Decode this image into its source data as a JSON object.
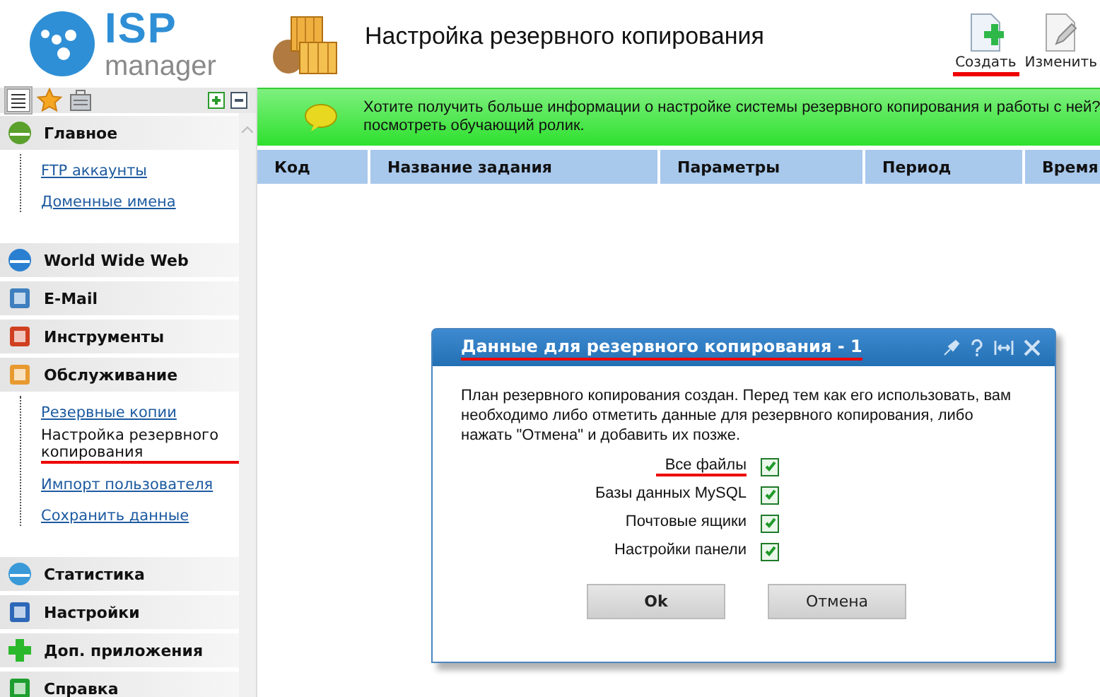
{
  "header": {
    "logo": {
      "brand": "ISP",
      "product": "manager"
    },
    "title": "Настройка резервного копирования",
    "toolbar": [
      {
        "label": "Создать",
        "kind": "create",
        "marked": true
      },
      {
        "label": "Изменить",
        "kind": "edit",
        "marked": false
      }
    ]
  },
  "sidebar": {
    "sections": [
      {
        "title": "Главное",
        "kind": "home",
        "items": [
          {
            "label": "FTP аккаунты",
            "selected": false,
            "marked": false
          },
          {
            "label": "Доменные имена",
            "selected": false,
            "marked": false
          }
        ]
      },
      {
        "title": "World Wide Web",
        "kind": "web"
      },
      {
        "title": "E-Mail",
        "kind": "mail"
      },
      {
        "title": "Инструменты",
        "kind": "tools"
      },
      {
        "title": "Обслуживание",
        "kind": "service",
        "items": [
          {
            "label": "Резервные копии",
            "selected": false,
            "marked": false
          },
          {
            "label": "Настройка резервного копирования",
            "selected": true,
            "marked": true
          },
          {
            "label": "Импорт пользователя",
            "selected": false,
            "marked": false
          },
          {
            "label": "Сохранить данные",
            "selected": false,
            "marked": false
          }
        ]
      },
      {
        "title": "Статистика",
        "kind": "stats"
      },
      {
        "title": "Настройки",
        "kind": "settings"
      },
      {
        "title": "Доп. приложения",
        "kind": "addons"
      },
      {
        "title": "Справка",
        "kind": "help"
      }
    ]
  },
  "banner": {
    "lines": [
      "Хотите получить больше информации о настройке системы резервного копирования и работы с ней?",
      "посмотреть обучающий ролик."
    ]
  },
  "table": {
    "columns": [
      "Код",
      "Название задания",
      "Параметры",
      "Период",
      "Время"
    ]
  },
  "dialog": {
    "title": "Данные для резервного копирования - 1",
    "title_marked": true,
    "message": "План резервного копирования создан. Перед тем как его использовать, вам необходимо либо отметить данные для резервного копирования, либо нажать \"Отмена\" и добавить их позже.",
    "options": [
      {
        "label": "Все файлы",
        "checked": true,
        "marked": true
      },
      {
        "label": "Базы данных MySQL",
        "checked": true,
        "marked": false
      },
      {
        "label": "Почтовые ящики",
        "checked": true,
        "marked": false
      },
      {
        "label": "Настройки панели",
        "checked": true,
        "marked": false
      }
    ],
    "buttons": [
      {
        "label": "Ok",
        "kind": "primary"
      },
      {
        "label": "Отмена",
        "kind": "secondary"
      }
    ]
  }
}
